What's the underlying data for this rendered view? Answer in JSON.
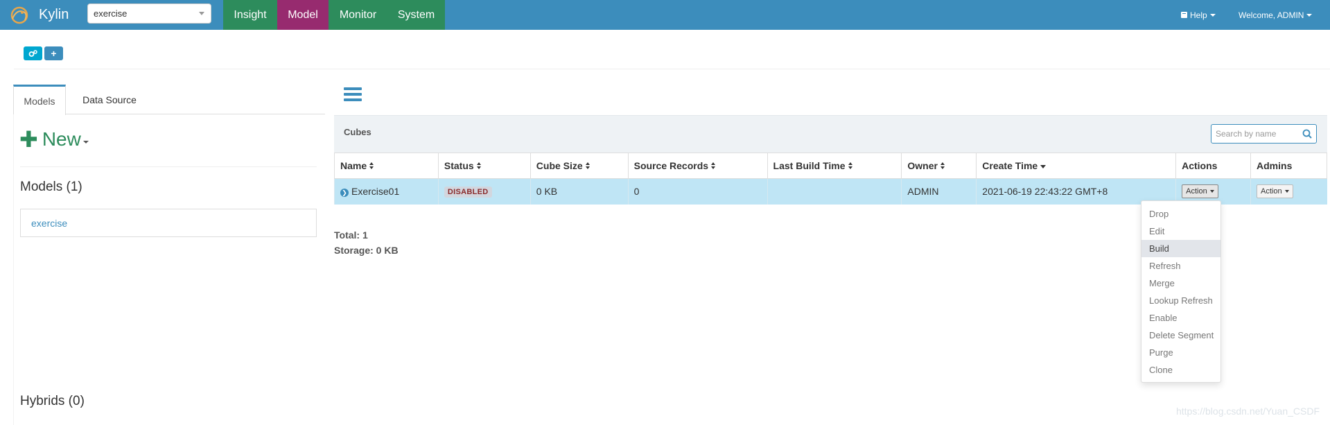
{
  "header": {
    "app_name": "Kylin",
    "project": "exercise",
    "nav": [
      {
        "label": "Insight",
        "active": false
      },
      {
        "label": "Model",
        "active": true
      },
      {
        "label": "Monitor",
        "active": false
      },
      {
        "label": "System",
        "active": false
      }
    ],
    "help_label": "Help",
    "welcome_label": "Welcome, ADMIN"
  },
  "toolbar": {
    "icons": [
      "cogs-icon",
      "plus-icon"
    ]
  },
  "sidebar": {
    "tabs": [
      {
        "label": "Models",
        "active": true
      },
      {
        "label": "Data Source",
        "active": false
      }
    ],
    "new_label": "New",
    "models_title": "Models (1)",
    "models": [
      "exercise"
    ],
    "hybrids_title": "Hybrids (0)"
  },
  "cubes": {
    "title": "Cubes",
    "search_placeholder": "Search by name",
    "columns": [
      "Name",
      "Status",
      "Cube Size",
      "Source Records",
      "Last Build Time",
      "Owner",
      "Create Time",
      "Actions",
      "Admins"
    ],
    "rows": [
      {
        "name": "Exercise01",
        "status": "DISABLED",
        "cube_size": "0 KB",
        "source_records": "0",
        "last_build_time": "",
        "owner": "ADMIN",
        "create_time": "2021-06-19 22:43:22 GMT+8",
        "action_label": "Action",
        "admin_label": "Action"
      }
    ],
    "total_label": "Total: 1",
    "storage_label": "Storage: 0 KB"
  },
  "action_menu": {
    "items": [
      "Drop",
      "Edit",
      "Build",
      "Refresh",
      "Merge",
      "Lookup Refresh",
      "Enable",
      "Delete Segment",
      "Purge",
      "Clone"
    ],
    "highlighted": "Build"
  },
  "watermark": "https://blog.csdn.net/Yuan_CSDF",
  "colors": {
    "topbar": "#3c8dbc",
    "nav": "#2d8c5c",
    "nav_active": "#972b6f",
    "row_selected": "#bfe5f5"
  }
}
